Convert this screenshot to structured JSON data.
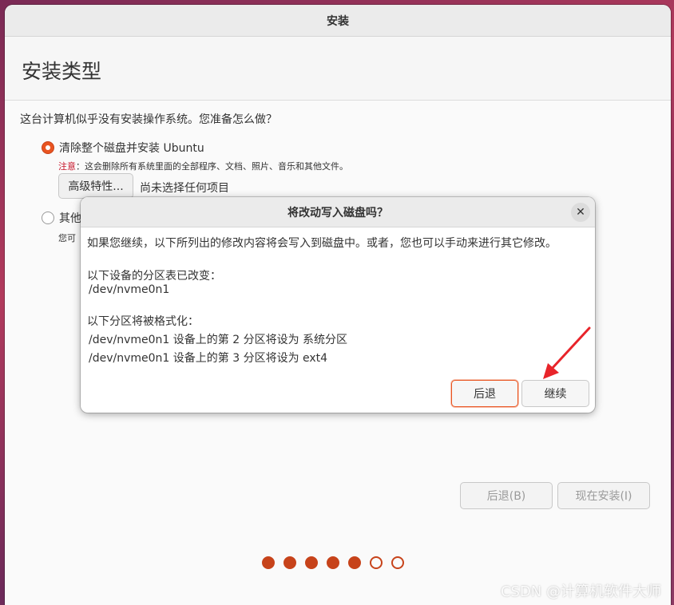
{
  "window": {
    "title": "安装",
    "heading": "安装类型"
  },
  "main": {
    "question": "这台计算机似乎没有安装操作系统。您准备怎么做？",
    "option1": {
      "label": "清除整个磁盘并安装 Ubuntu",
      "note_prefix": "注意",
      "note_text": "：这会删除所有系统里面的全部程序、文档、照片、音乐和其他文件。",
      "advanced_button": "高级特性...",
      "advanced_status": "尚未选择任何项目"
    },
    "option2": {
      "label": "其他",
      "sublabel": "您可"
    },
    "buttons": {
      "back": "后退(B)",
      "install": "现在安装(I)"
    },
    "progress": {
      "total_steps": 7,
      "completed_steps": 5
    }
  },
  "dialog": {
    "title": "将改动写入磁盘吗？",
    "intro": "如果您继续，以下所列出的修改内容将会写入到磁盘中。或者，您也可以手动来进行其它修改。",
    "partition_table_heading": "以下设备的分区表已改变：",
    "partition_table_devices": [
      "/dev/nvme0n1"
    ],
    "format_heading": "以下分区将被格式化：",
    "format_items": [
      "/dev/nvme0n1 设备上的第 2 分区将设为 系统分区",
      "/dev/nvme0n1 设备上的第 3 分区将设为 ext4"
    ],
    "back_button": "后退",
    "continue_button": "继续"
  },
  "annotation": {
    "arrow_color": "#e8242a"
  },
  "watermark": "CSDN @计算机软件大师",
  "colors": {
    "accent": "#e95420",
    "warning": "#c7162b"
  }
}
